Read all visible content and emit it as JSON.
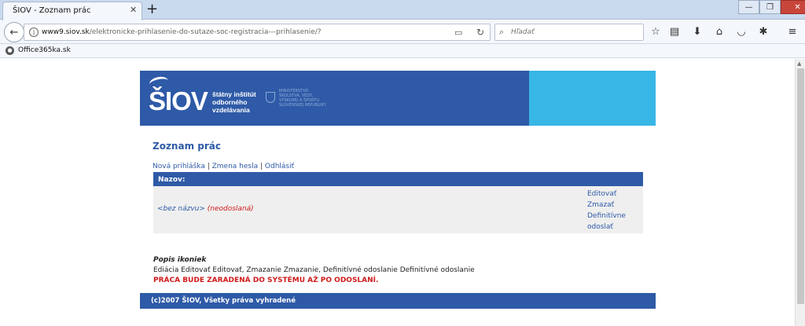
{
  "browser": {
    "tab_title": "ŠIOV - Zoznam prác",
    "url_host": "www9.siov.sk",
    "url_path": "/elektronicke-prihlasenie-do-sutaze-soc-registracia---prihlasenie/?",
    "search_placeholder": "Hľadať",
    "bookmark_label": "Office365ka.sk"
  },
  "header": {
    "logo": "ŠIOV",
    "logo_sub": [
      "štátny inštitút",
      "odborného",
      "vzdelávania"
    ],
    "ministry": [
      "MINISTERSTVO",
      "ŠKOLSTVA, VEDY,",
      "VÝSKUMU A ŠPORTU",
      "SLOVENSKEJ REPUBLIKY"
    ]
  },
  "main": {
    "title": "Zoznam prác",
    "links": [
      "Nová prihláška",
      "Zmena hesla",
      "Odhlásiť"
    ],
    "table_header": "Nazov:",
    "row": {
      "name": "<bez názvu>",
      "status": "(neodoslaná)",
      "actions": [
        "Editovať",
        "Zmazať",
        "Definitívne",
        "odoslať"
      ]
    },
    "legend_title": "Popis ikoniek",
    "legend_text": "Ediácia Editovať Editovať, Zmazanie Zmazanie, Definitívné odoslanie Definitívné odoslanie",
    "warning": "PRÁCA BUDE ZARADENÁ DO SYSTÉMU AŽ PO ODOSLANÍ.",
    "footer": "(c)2007 ŠIOV, Všetky práva vyhradené"
  },
  "colors": {
    "brand_blue": "#2e5aa7",
    "accent_cyan": "#38b6e6",
    "warning_red": "#d01a1a"
  }
}
